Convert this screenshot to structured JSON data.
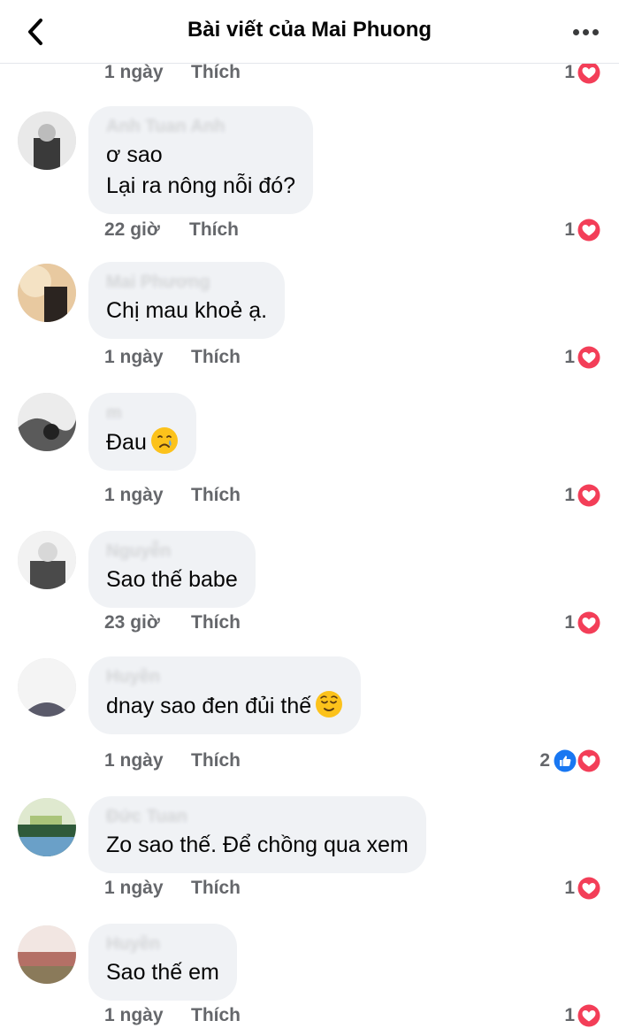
{
  "header": {
    "title": "Bài viết của Mai Phuong",
    "back_icon": "chevron-left-icon",
    "more_icon": "more-horizontal-icon"
  },
  "like_label": "Thích",
  "colors": {
    "heart": "#f33e58",
    "like_blue": "#1877f2",
    "meta_gray": "#65676b",
    "bubble_bg": "#f0f2f5"
  },
  "top_partial": {
    "time": "1 ngày",
    "reactions": "1"
  },
  "comments": [
    {
      "author": "Anh Tuan Anh",
      "lines": [
        "ơ sao",
        "Lại ra nông nỗi đó?"
      ],
      "time": "22 giờ",
      "reactions": "1"
    },
    {
      "author": "Mai Phương",
      "lines": [
        "Chị mau khoẻ ạ."
      ],
      "time": "1 ngày",
      "reactions": "1"
    },
    {
      "author": "m",
      "lines": [
        "Đau"
      ],
      "emoji": "crying-face-emoji",
      "time": "1 ngày",
      "reactions": "1"
    },
    {
      "author": "Nguyễn",
      "lines": [
        "Sao thế babe"
      ],
      "time": "23 giờ",
      "reactions": "1"
    },
    {
      "author": "Huyền",
      "lines": [
        "dnay sao đen đủi thế"
      ],
      "emoji": "relieved-face-emoji",
      "time": "1 ngày",
      "reactions": "2"
    },
    {
      "author": "Đức Tuan",
      "lines": [
        "Zo sao thế. Để chồng qua xem"
      ],
      "time": "1 ngày",
      "reactions": "1"
    },
    {
      "author": "Huyền",
      "lines": [
        "Sao thế em"
      ],
      "time": "1 ngày",
      "reactions": "1"
    }
  ]
}
